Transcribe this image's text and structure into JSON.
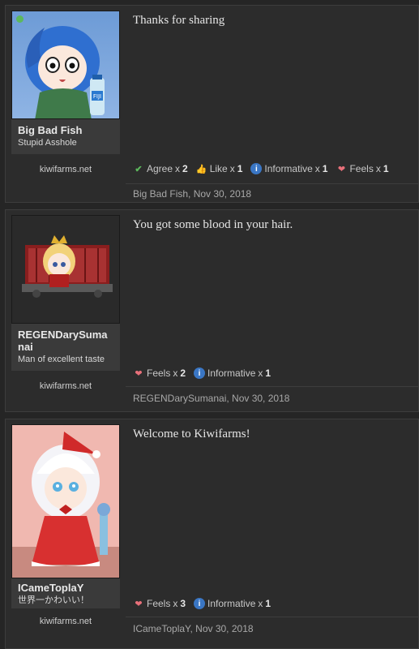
{
  "posts": [
    {
      "username": "Big Bad Fish",
      "user_title": "Stupid Asshole",
      "site": "kiwifarms.net",
      "message": "Thanks for sharing",
      "reactions": [
        {
          "icon": "check-icon",
          "label": "Agree",
          "count": "2"
        },
        {
          "icon": "thumbs-up-icon",
          "label": "Like",
          "count": "1"
        },
        {
          "icon": "info-icon",
          "label": "Informative",
          "count": "1"
        },
        {
          "icon": "heart-icon",
          "label": "Feels",
          "count": "1"
        }
      ],
      "byline": "Big Bad Fish, Nov 30, 2018",
      "avatar_text": "FIJI"
    },
    {
      "username": "REGENDarySumanai",
      "user_title": "Man of excellent taste",
      "site": "kiwifarms.net",
      "message": "You got some blood in your hair.",
      "reactions": [
        {
          "icon": "heart-icon",
          "label": "Feels",
          "count": "2"
        },
        {
          "icon": "info-icon",
          "label": "Informative",
          "count": "1"
        }
      ],
      "byline": "REGENDarySumanai, Nov 30, 2018"
    },
    {
      "username": "ICameToplaY",
      "user_title": "世界一かわいい！",
      "site": "kiwifarms.net",
      "message": "Welcome to Kiwifarms!",
      "reactions": [
        {
          "icon": "heart-icon",
          "label": "Feels",
          "count": "3"
        },
        {
          "icon": "info-icon",
          "label": "Informative",
          "count": "1"
        }
      ],
      "byline": "ICameToplaY, Nov 30, 2018"
    }
  ],
  "colors": {
    "agree": "#5cb85c",
    "info": "#3a76c4",
    "heart": "#e8707a",
    "like": "#e0a060"
  },
  "reaction_count_prefix": "x"
}
